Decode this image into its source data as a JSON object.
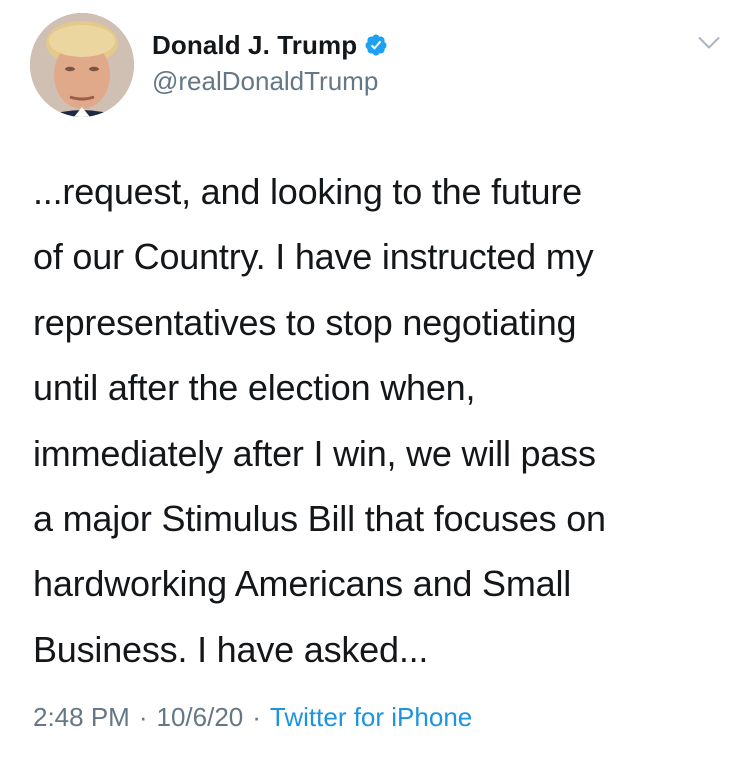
{
  "tweet": {
    "author": {
      "display_name": "Donald J. Trump",
      "handle": "@realDonaldTrump",
      "verified": true,
      "avatar_icon": "profile-photo"
    },
    "menu_icon": "chevron-down-icon",
    "text": "...request, and looking to the future\nof our Country. I have instructed my\nrepresentatives to stop negotiating\nuntil after the election when,\nimmediately after I win, we will pass\na major Stimulus Bill that focuses on\nhardworking Americans and Small\nBusiness. I have asked...",
    "meta": {
      "time": "2:48 PM",
      "separator": "·",
      "date": "10/6/20",
      "source": "Twitter for iPhone"
    },
    "colors": {
      "text": "#14171a",
      "secondary": "#657786",
      "link": "#1b95e0",
      "verified_badge": "#1da1f2"
    }
  }
}
